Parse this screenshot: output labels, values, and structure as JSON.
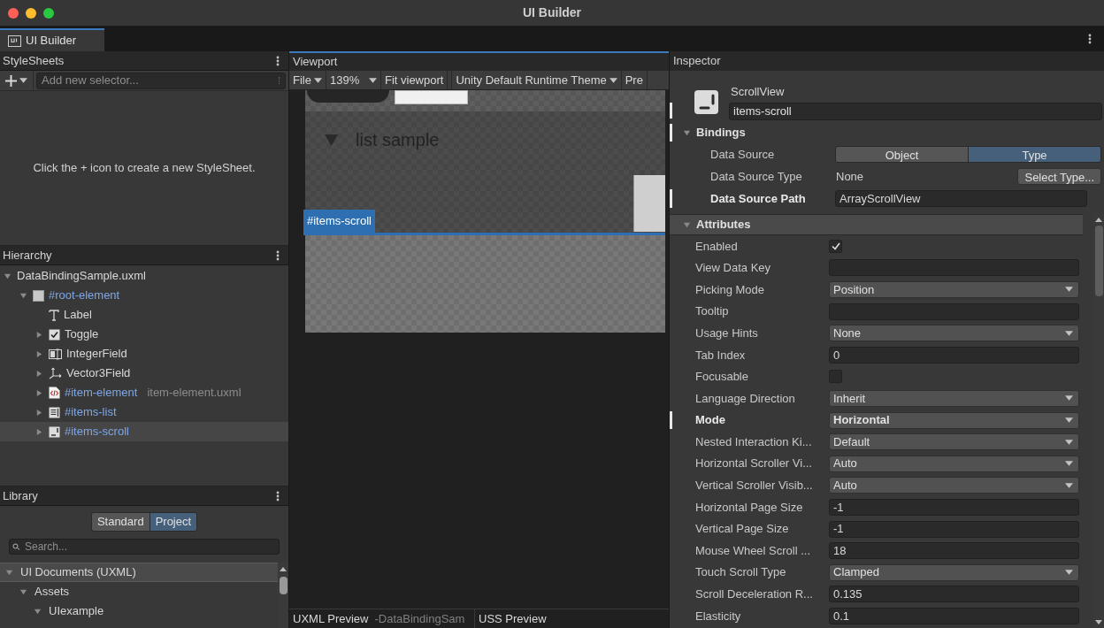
{
  "window": {
    "title": "UI Builder"
  },
  "tabs": [
    {
      "label": "UI Builder",
      "selected": true
    }
  ],
  "stylesheets": {
    "title": "StyleSheets",
    "selector_placeholder": "Add new selector...",
    "empty_message": "Click the + icon to create a new StyleSheet."
  },
  "hierarchy": {
    "title": "Hierarchy",
    "tree": [
      {
        "label": "DataBindingSample.uxml",
        "named": false,
        "expanded": true,
        "selected": false,
        "children": [
          {
            "label": "#root-element",
            "kind": "visual-element",
            "named": true,
            "expanded": true,
            "selected": false,
            "children": [
              {
                "label": "Label",
                "kind": "label",
                "named": false,
                "selected": false
              },
              {
                "label": "Toggle",
                "kind": "toggle",
                "named": false,
                "expanded": false,
                "selected": false
              },
              {
                "label": "IntegerField",
                "kind": "integer-field",
                "named": false,
                "expanded": false,
                "selected": false
              },
              {
                "label": "Vector3Field",
                "kind": "vector3-field",
                "named": false,
                "expanded": false,
                "selected": false
              },
              {
                "label": "#item-element",
                "source": "item-element.uxml",
                "kind": "template",
                "named": true,
                "expanded": false,
                "selected": false
              },
              {
                "label": "#items-list",
                "kind": "list-view",
                "named": true,
                "expanded": false,
                "selected": false
              },
              {
                "label": "#items-scroll",
                "kind": "scroll-view",
                "named": true,
                "expanded": false,
                "selected": true
              }
            ]
          }
        ]
      }
    ]
  },
  "library": {
    "title": "Library",
    "tabs": [
      {
        "label": "Standard",
        "selected": false
      },
      {
        "label": "Project",
        "selected": true
      }
    ],
    "search": {
      "placeholder": "Search..."
    },
    "tree": [
      {
        "label": "UI Documents (UXML)",
        "kind": "category",
        "expanded": true,
        "children": [
          {
            "label": "Assets",
            "expanded": true,
            "children": [
              {
                "label": "UIexample",
                "expanded": true
              }
            ]
          }
        ]
      }
    ]
  },
  "viewport": {
    "title": "Viewport",
    "toolbar": [
      {
        "label": "File",
        "kind": "menu"
      },
      {
        "label": "139%",
        "kind": "zoom"
      },
      {
        "label": "Fit viewport",
        "kind": "button"
      },
      {
        "label": "Unity Default Runtime Theme",
        "kind": "menu"
      },
      {
        "label": "Pre",
        "kind": "button"
      }
    ],
    "canvas": {
      "heading": "list sample",
      "selection_label": "#items-scroll"
    },
    "bottom_tabs": [
      {
        "label": "UXML Preview",
        "detail": "-DataBindingSam"
      },
      {
        "label": "USS Preview"
      }
    ]
  },
  "inspector": {
    "title": "Inspector",
    "element": {
      "type": "ScrollView",
      "name": "items-scroll",
      "overridden": true
    },
    "sections": [
      {
        "title": "Bindings",
        "kind": "group",
        "expanded": true,
        "overridden": true,
        "rows": [
          {
            "label": "Data Source",
            "kind": "segmented",
            "overridden": false,
            "options": [
              {
                "label": "Object",
                "selected": false
              },
              {
                "label": "Type",
                "selected": true
              }
            ]
          },
          {
            "label": "Data Source Type",
            "kind": "type-picker",
            "overridden": false,
            "value": "None",
            "button": "Select Type..."
          },
          {
            "label": "Data Source Path",
            "kind": "text",
            "overridden": true,
            "value": "ArrayScrollView"
          }
        ]
      },
      {
        "title": "Attributes",
        "kind": "category",
        "expanded": true,
        "overridden": false,
        "rows": [
          {
            "label": "Enabled",
            "kind": "checkbox",
            "overridden": false,
            "checked": true
          },
          {
            "label": "View Data Key",
            "kind": "text",
            "overridden": false,
            "value": ""
          },
          {
            "label": "Picking Mode",
            "kind": "dropdown",
            "overridden": false,
            "value": "Position"
          },
          {
            "label": "Tooltip",
            "kind": "text",
            "overridden": false,
            "value": ""
          },
          {
            "label": "Usage Hints",
            "kind": "dropdown",
            "overridden": false,
            "value": "None"
          },
          {
            "label": "Tab Index",
            "kind": "text",
            "overridden": false,
            "value": "0"
          },
          {
            "label": "Focusable",
            "kind": "checkbox",
            "overridden": false,
            "checked": false
          },
          {
            "label": "Language Direction",
            "kind": "dropdown",
            "overridden": false,
            "value": "Inherit"
          },
          {
            "label": "Mode",
            "kind": "dropdown",
            "overridden": true,
            "value": "Horizontal"
          },
          {
            "label": "Nested Interaction Ki...",
            "kind": "dropdown",
            "overridden": false,
            "value": "Default"
          },
          {
            "label": "Horizontal Scroller Vi...",
            "kind": "dropdown",
            "overridden": false,
            "value": "Auto"
          },
          {
            "label": "Vertical Scroller Visib...",
            "kind": "dropdown",
            "overridden": false,
            "value": "Auto"
          },
          {
            "label": "Horizontal Page Size",
            "kind": "text",
            "overridden": false,
            "value": "-1"
          },
          {
            "label": "Vertical Page Size",
            "kind": "text",
            "overridden": false,
            "value": "-1"
          },
          {
            "label": "Mouse Wheel Scroll ...",
            "kind": "text",
            "overridden": false,
            "value": "18"
          },
          {
            "label": "Touch Scroll Type",
            "kind": "dropdown",
            "overridden": false,
            "value": "Clamped"
          },
          {
            "label": "Scroll Deceleration R...",
            "kind": "text",
            "overridden": false,
            "value": "0.135"
          },
          {
            "label": "Elasticity",
            "kind": "text",
            "overridden": false,
            "value": "0.1"
          }
        ]
      }
    ]
  }
}
